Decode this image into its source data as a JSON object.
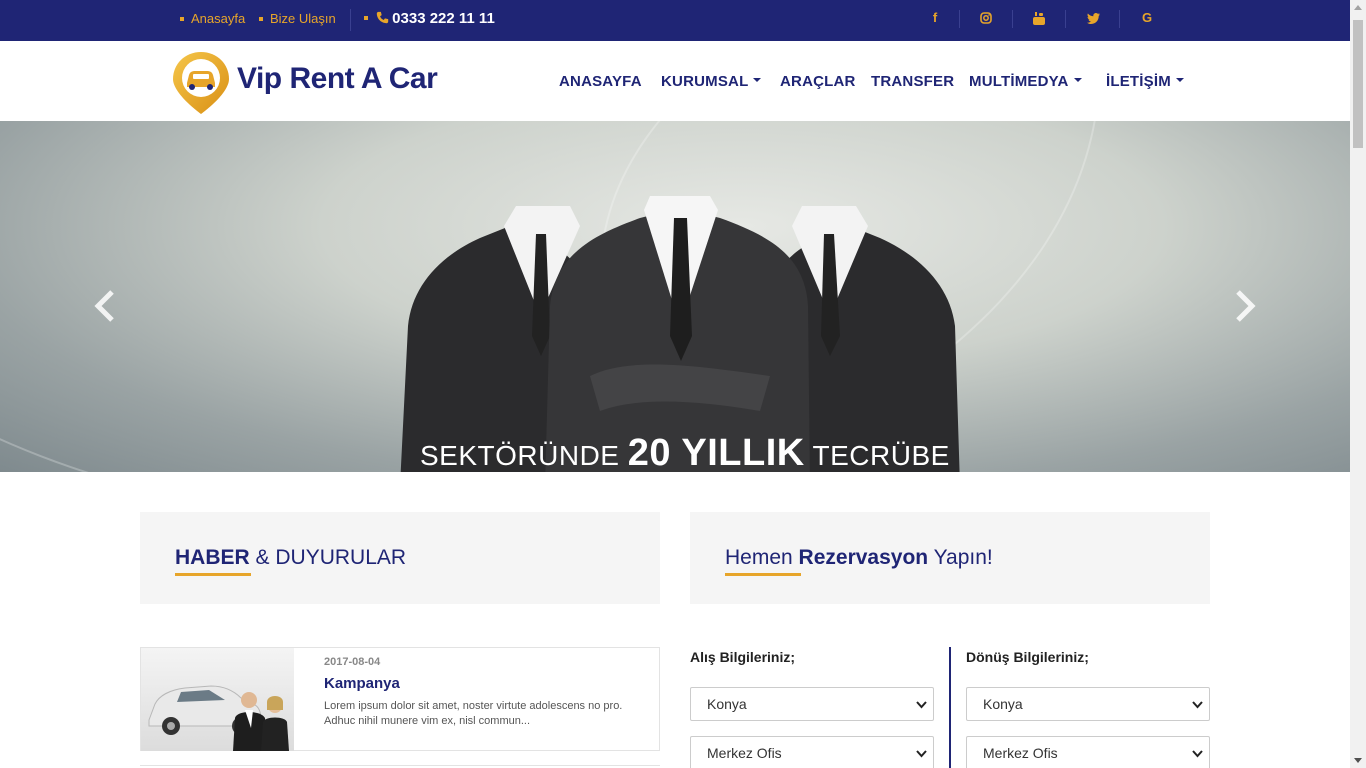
{
  "topbar": {
    "links": [
      "Anasayfa",
      "Bize Ulaşın"
    ],
    "phone": "0333 222 11 11",
    "social": [
      "facebook-icon",
      "instagram-icon",
      "youtube-icon",
      "twitter-icon",
      "google-icon"
    ]
  },
  "brand": {
    "name": "Vip Rent A Car"
  },
  "nav": {
    "items": [
      "ANASAYFA",
      "KURUMSAL",
      "ARAÇLAR",
      "TRANSFER",
      "MULTİMEDYA",
      "İLETİŞİM"
    ]
  },
  "slider": {
    "caption_pre": "SEKTÖRÜNDE",
    "caption_bold": "20 YILLIK",
    "caption_post": "TECRÜBE"
  },
  "news_panel": {
    "title_bold": "HABER",
    "title_rest": "& DUYURULAR"
  },
  "reservation_panel": {
    "title_pre": "Hemen",
    "title_bold": "Rezervasyon",
    "title_post": "Yapın!"
  },
  "news": [
    {
      "date": "2017-08-04",
      "title": "Kampanya",
      "excerpt": "Lorem ipsum dolor sit amet, noster virtute adolescens no pro. Adhuc nihil munere vim ex, nisl commun..."
    }
  ],
  "form": {
    "pickup_label": "Alış Bilgileriniz;",
    "return_label": "Dönüş Bilgileriniz;",
    "pickup_city": "Konya",
    "pickup_office": "Merkez Ofis",
    "return_city": "Konya",
    "return_office": "Merkez Ofis"
  },
  "colors": {
    "navy": "#1f2575",
    "gold": "#e7a52a"
  }
}
